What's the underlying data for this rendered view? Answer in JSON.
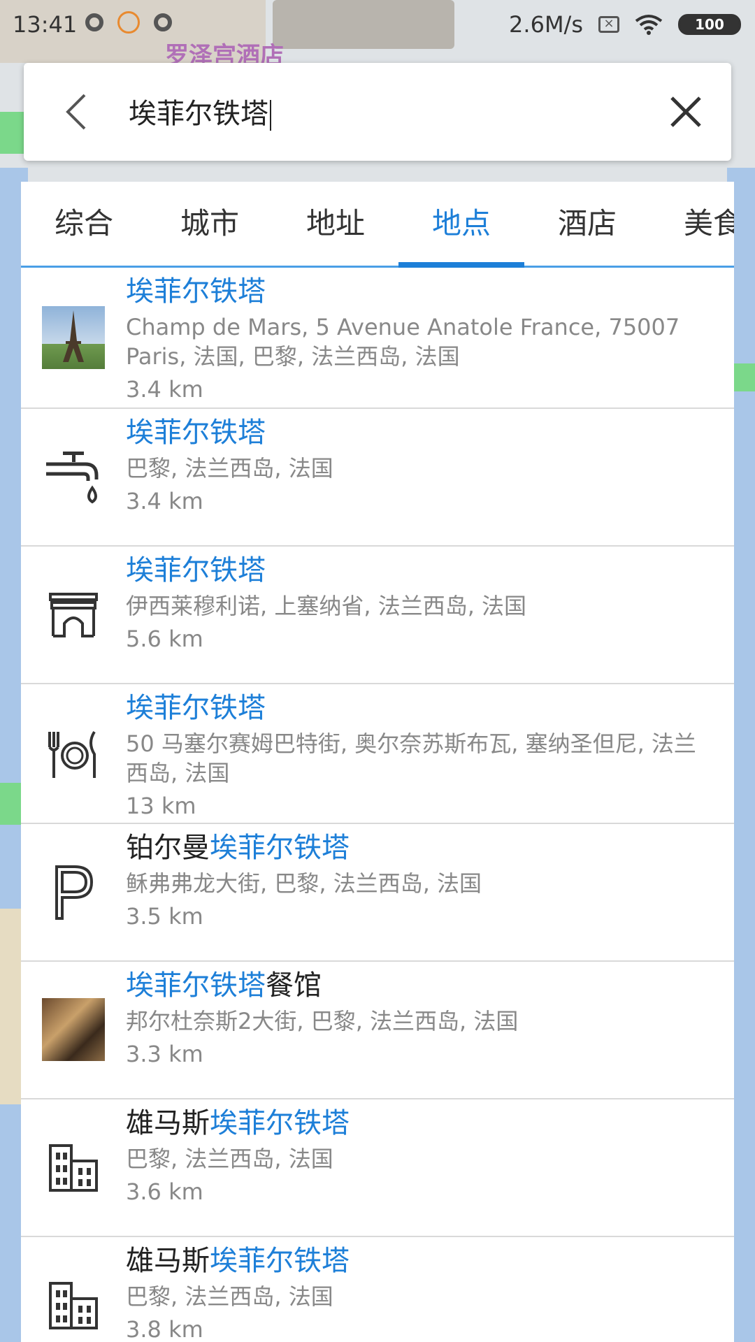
{
  "status_bar": {
    "time": "13:41",
    "speed": "2.6M/s",
    "battery": "100"
  },
  "map": {
    "label_top": "罗泽宫酒店"
  },
  "search": {
    "query": "埃菲尔铁塔"
  },
  "tabs": [
    {
      "label": "综合",
      "active": false
    },
    {
      "label": "城市",
      "active": false
    },
    {
      "label": "地址",
      "active": false
    },
    {
      "label": "地点",
      "active": true
    },
    {
      "label": "酒店",
      "active": false
    },
    {
      "label": "美食",
      "active": false
    }
  ],
  "results": [
    {
      "prefix": "",
      "highlight": "埃菲尔铁塔",
      "suffix": "",
      "address": "Champ de Mars, 5 Avenue Anatole France, 75007 Paris, 法国, 巴黎, 法兰西岛, 法国",
      "distance": "3.4 km",
      "icon": "eiffel-photo"
    },
    {
      "prefix": "",
      "highlight": "埃菲尔铁塔",
      "suffix": "",
      "address": "巴黎, 法兰西岛, 法国",
      "distance": "3.4 km",
      "icon": "water-tap-icon"
    },
    {
      "prefix": "",
      "highlight": "埃菲尔铁塔",
      "suffix": "",
      "address": "伊西莱穆利诺, 上塞纳省, 法兰西岛, 法国",
      "distance": "5.6 km",
      "icon": "arch-icon"
    },
    {
      "prefix": "",
      "highlight": "埃菲尔铁塔",
      "suffix": "",
      "address": "50 马塞尔赛姆巴特街, 奥尔奈苏斯布瓦, 塞纳圣但尼, 法兰西岛, 法国",
      "distance": "13 km",
      "icon": "restaurant-icon"
    },
    {
      "prefix": "铂尔曼",
      "highlight": "埃菲尔铁塔",
      "suffix": "",
      "address": "稣弗弗龙大街, 巴黎, 法兰西岛, 法国",
      "distance": "3.5 km",
      "icon": "parking-icon"
    },
    {
      "prefix": "",
      "highlight": "埃菲尔铁塔",
      "suffix": "餐馆",
      "address": "邦尔杜奈斯2大街, 巴黎, 法兰西岛, 法国",
      "distance": "3.3 km",
      "icon": "restaurant-photo"
    },
    {
      "prefix": "雄马斯",
      "highlight": "埃菲尔铁塔",
      "suffix": "",
      "address": "巴黎, 法兰西岛, 法国",
      "distance": "3.6 km",
      "icon": "building-icon"
    },
    {
      "prefix": "雄马斯",
      "highlight": "埃菲尔铁塔",
      "suffix": "",
      "address": "巴黎, 法兰西岛, 法国",
      "distance": "3.8 km",
      "icon": "building-icon"
    }
  ]
}
